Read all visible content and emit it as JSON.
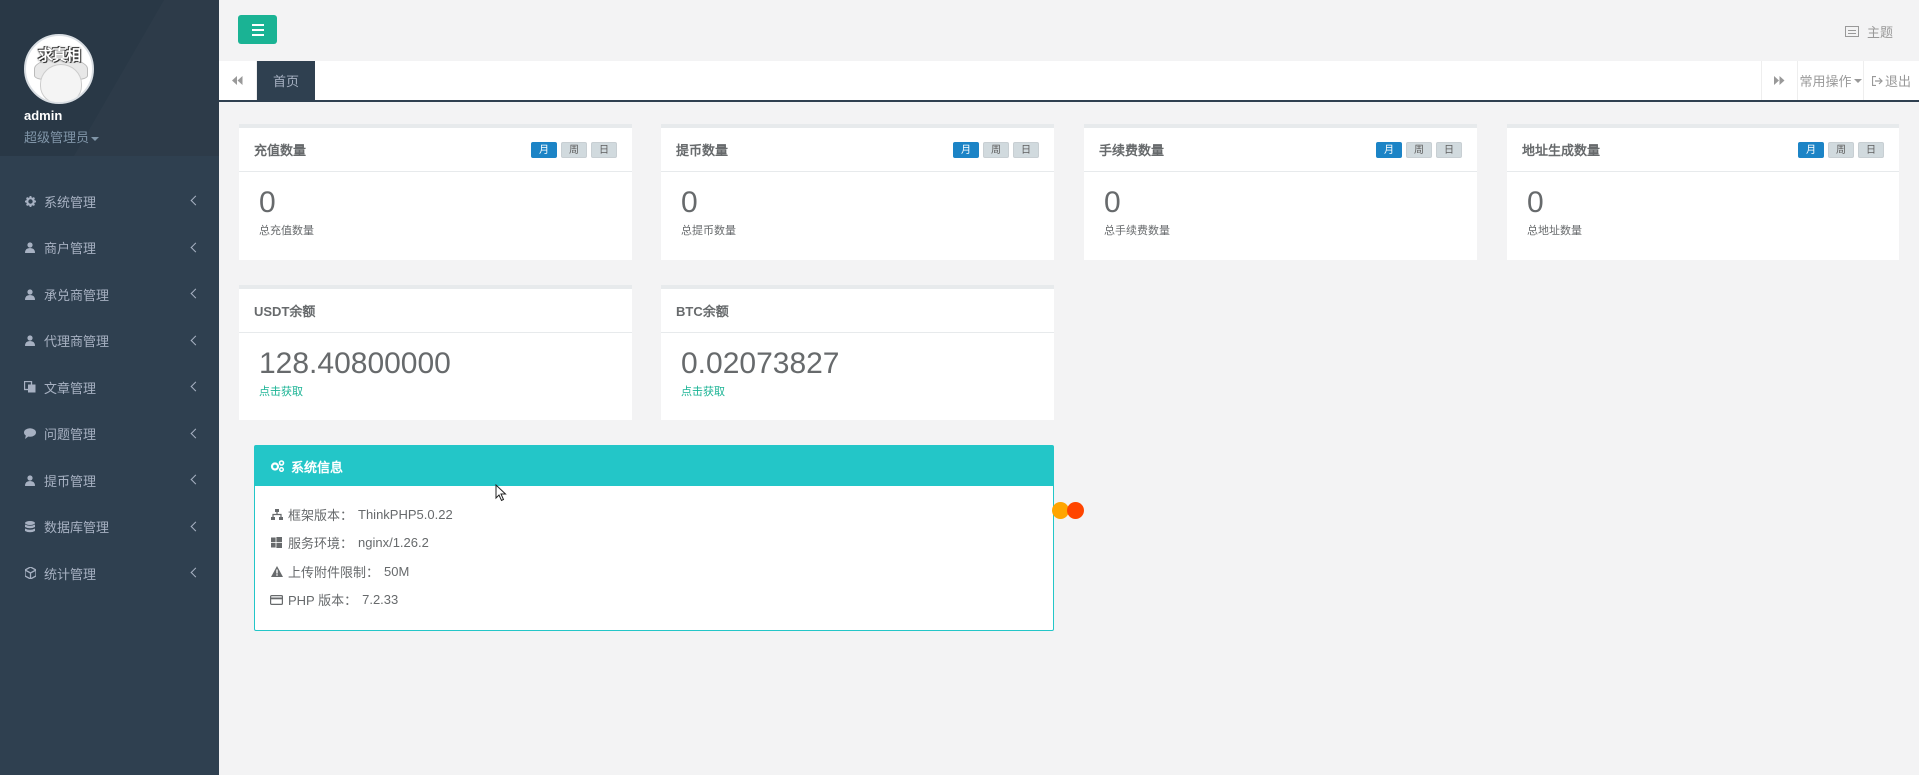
{
  "sidebar": {
    "avatar_text": "求真相",
    "username": "admin",
    "role": "超级管理员",
    "items": [
      {
        "label": "系统管理",
        "icon": "gear-icon"
      },
      {
        "label": "商户管理",
        "icon": "user-icon"
      },
      {
        "label": "承兑商管理",
        "icon": "user-icon"
      },
      {
        "label": "代理商管理",
        "icon": "user-icon"
      },
      {
        "label": "文章管理",
        "icon": "copy-icon"
      },
      {
        "label": "问题管理",
        "icon": "comment-icon"
      },
      {
        "label": "提币管理",
        "icon": "user-icon"
      },
      {
        "label": "数据库管理",
        "icon": "database-icon"
      },
      {
        "label": "统计管理",
        "icon": "cube-icon"
      }
    ]
  },
  "topbar": {
    "theme_label": "主题"
  },
  "tabs": {
    "active": "首页",
    "ops_label": "常用操作",
    "exit_label": "退出"
  },
  "stats": {
    "period_labels": [
      "月",
      "周",
      "日"
    ],
    "cards": [
      {
        "title": "充值数量",
        "value": "0",
        "sub": "总充值数量"
      },
      {
        "title": "提币数量",
        "value": "0",
        "sub": "总提币数量"
      },
      {
        "title": "手续费数量",
        "value": "0",
        "sub": "总手续费数量"
      },
      {
        "title": "地址生成数量",
        "value": "0",
        "sub": "总地址数量"
      }
    ],
    "balances": [
      {
        "title": "USDT余额",
        "value": "128.40800000",
        "link": "点击获取"
      },
      {
        "title": "BTC余额",
        "value": "0.02073827",
        "link": "点击获取"
      }
    ]
  },
  "sysinfo": {
    "title": "系统信息",
    "rows": [
      {
        "label": "框架版本：",
        "value": "ThinkPHP5.0.22",
        "icon": "sitemap-icon"
      },
      {
        "label": "服务环境：",
        "value": "nginx/1.26.2",
        "icon": "windows-icon"
      },
      {
        "label": "上传附件限制：",
        "value": "50M",
        "icon": "warning-icon"
      },
      {
        "label": "PHP 版本：",
        "value": "7.2.33",
        "icon": "credit-card-icon"
      }
    ]
  },
  "colors": {
    "sidebar_bg": "#2f4050",
    "accent_green": "#1ab394",
    "accent_blue": "#1c84c6",
    "panel_cyan": "#23c6c8"
  }
}
